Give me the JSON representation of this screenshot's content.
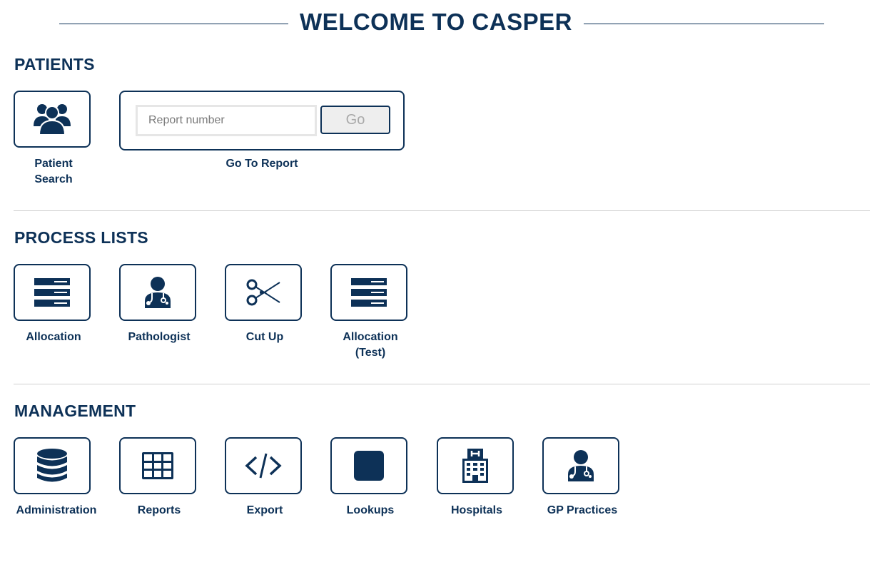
{
  "header": {
    "title": "WELCOME TO CASPER"
  },
  "patients": {
    "title": "PATIENTS",
    "patient_search": {
      "label_line1": "Patient",
      "label_line2": "Search",
      "icon": "users-icon"
    },
    "go_to_report": {
      "placeholder": "Report number",
      "button_label": "Go",
      "label": "Go To Report"
    }
  },
  "process_lists": {
    "title": "PROCESS LISTS",
    "items": [
      {
        "label": "Allocation",
        "icon": "list-icon"
      },
      {
        "label": "Pathologist",
        "icon": "doctor-icon"
      },
      {
        "label": "Cut Up",
        "icon": "scissors-icon"
      },
      {
        "label": "Allocation",
        "label_line2": "(Test)",
        "icon": "list-icon"
      }
    ]
  },
  "management": {
    "title": "MANAGEMENT",
    "items": [
      {
        "label": "Administration",
        "icon": "database-icon"
      },
      {
        "label": "Reports",
        "icon": "table-icon"
      },
      {
        "label": "Export",
        "icon": "code-icon"
      },
      {
        "label": "Lookups",
        "icon": "square-icon"
      },
      {
        "label": "Hospitals",
        "icon": "hospital-icon"
      },
      {
        "label": "GP Practices",
        "icon": "doctor-icon"
      }
    ]
  },
  "colors": {
    "primary": "#0d3157",
    "divider": "#cfcfcf",
    "button_bg": "#eeeeee"
  }
}
